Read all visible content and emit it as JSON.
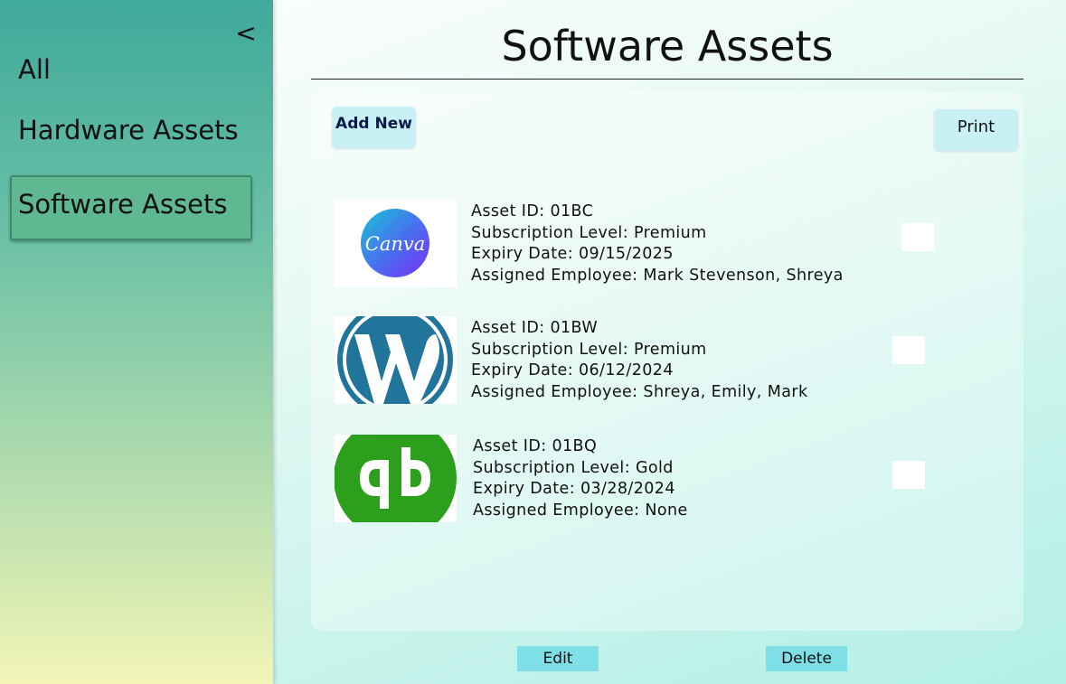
{
  "sidebar": {
    "collapse_glyph": "<",
    "items": [
      {
        "label": "All"
      },
      {
        "label": "Hardware Assets"
      },
      {
        "label": "Software Assets"
      }
    ]
  },
  "header": {
    "title": "Software Assets"
  },
  "toolbar": {
    "add_label": "Add New",
    "print_label": "Print"
  },
  "assets": [
    {
      "logo": "canva-logo",
      "logo_text": "Canva",
      "asset_id": "Asset ID: 01BC",
      "subscription": "Subscription Level: Premium",
      "expiry": "Expiry Date: 09/15/2025",
      "assigned": "Assigned Employee: Mark Stevenson, Shreya"
    },
    {
      "logo": "wordpress-logo",
      "asset_id": "Asset ID: 01BW",
      "subscription": "Subscription Level: Premium",
      "expiry": "Expiry Date: 06/12/2024",
      "assigned": "Assigned Employee: Shreya, Emily, Mark"
    },
    {
      "logo": "quickbooks-logo",
      "asset_id": "Asset ID: 01BQ",
      "subscription": "Subscription Level: Gold",
      "expiry": "Expiry Date: 03/28/2024",
      "assigned": "Assigned Employee: None"
    }
  ],
  "footer": {
    "edit_label": "Edit",
    "delete_label": "Delete"
  },
  "colors": {
    "sidebar_top": "#3fa99b",
    "sidebar_bottom": "#f2f5b6",
    "active_nav": "#5fb892",
    "button_light": "#c9f1f5",
    "button_footer": "#7fdfe6",
    "canva_gradient_start": "#19c3d6",
    "canva_gradient_end": "#7b2ff7",
    "wordpress_blue": "#21759b",
    "quickbooks_green": "#2ca01c"
  }
}
